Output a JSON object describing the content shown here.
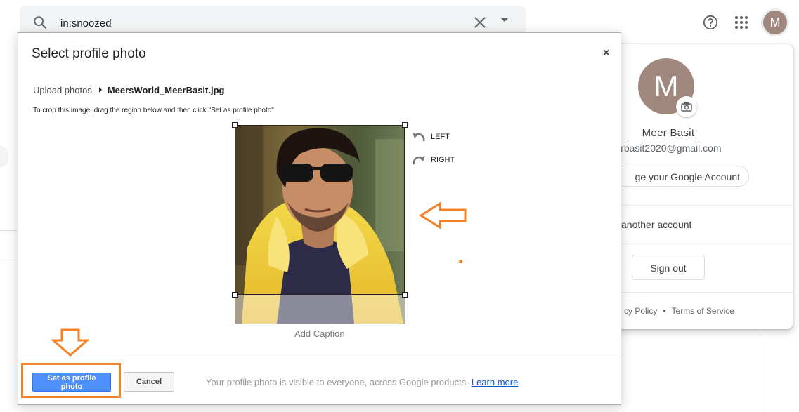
{
  "search": {
    "value": "in:snoozed"
  },
  "top_avatar_letter": "M",
  "account": {
    "avatar_letter": "M",
    "name": "Meer Basit",
    "email": "erbasit2020@gmail.com",
    "manage_label": "ge your Google Account",
    "add_account_label": "another account",
    "sign_out_label": "Sign out",
    "footer": {
      "privacy": "cy Policy",
      "separator": "•",
      "terms": "Terms of Service"
    }
  },
  "dialog": {
    "title": "Select profile photo",
    "close_glyph": "×",
    "breadcrumb": {
      "root": "Upload photos",
      "file": "MeersWorld_MeerBasit.jpg"
    },
    "instructions": "To crop this image, drag the region below and then click \"Set as profile photo\"",
    "rotate_left": "LEFT",
    "rotate_right": "RIGHT",
    "caption_placeholder": "Add Caption",
    "primary_button": "Set as profile photo",
    "cancel_button": "Cancel",
    "visibility_note": "Your profile photo is visible to everyone, across Google products.",
    "learn_more": "Learn more"
  },
  "colors": {
    "primary_blue": "#4d90fe",
    "annotation_orange": "#f58025",
    "avatar_brown": "#a1887f",
    "link_blue": "#1155cc"
  },
  "icons": [
    "search-icon",
    "clear-icon",
    "dropdown-caret-icon",
    "help-icon",
    "apps-grid-icon",
    "camera-icon",
    "rotate-left-icon",
    "rotate-right-icon",
    "close-icon"
  ]
}
